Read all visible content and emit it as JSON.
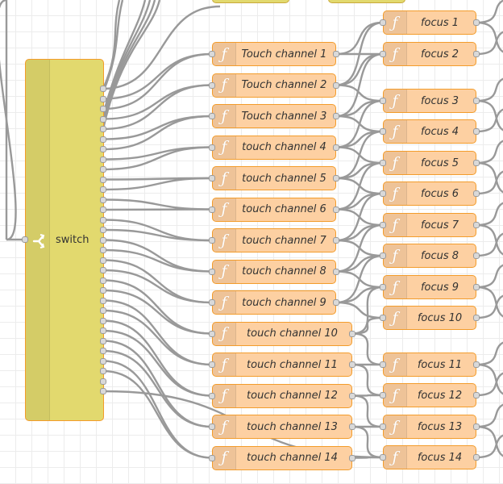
{
  "switch_node": {
    "label": "switch",
    "icon": "switch-icon",
    "outputs": 31
  },
  "function_icon": "ƒ",
  "function_nodes": [
    "Touch channel 1",
    "Touch channel 2",
    "Touch channel 3",
    "touch channel 4",
    "touch channel 5",
    "touch channel 6",
    "touch channel 7",
    "touch channel 8",
    "touch channel 9",
    "touch channel 10",
    "touch channel 11",
    "touch channel 12",
    "touch channel 13",
    "touch channel 14"
  ],
  "focus_nodes": [
    "focus 1",
    "focus 2",
    "focus 3",
    "focus 4",
    "focus 5",
    "focus 6",
    "focus 7",
    "focus 8",
    "focus 9",
    "focus 10",
    "focus 11",
    "focus 12",
    "focus 13",
    "focus 14"
  ],
  "colors": {
    "function_fill": "#fdd0a2",
    "function_border": "#f39c2b",
    "switch_fill": "#e2d96e",
    "wire": "#999999",
    "grid": "#ececec"
  }
}
